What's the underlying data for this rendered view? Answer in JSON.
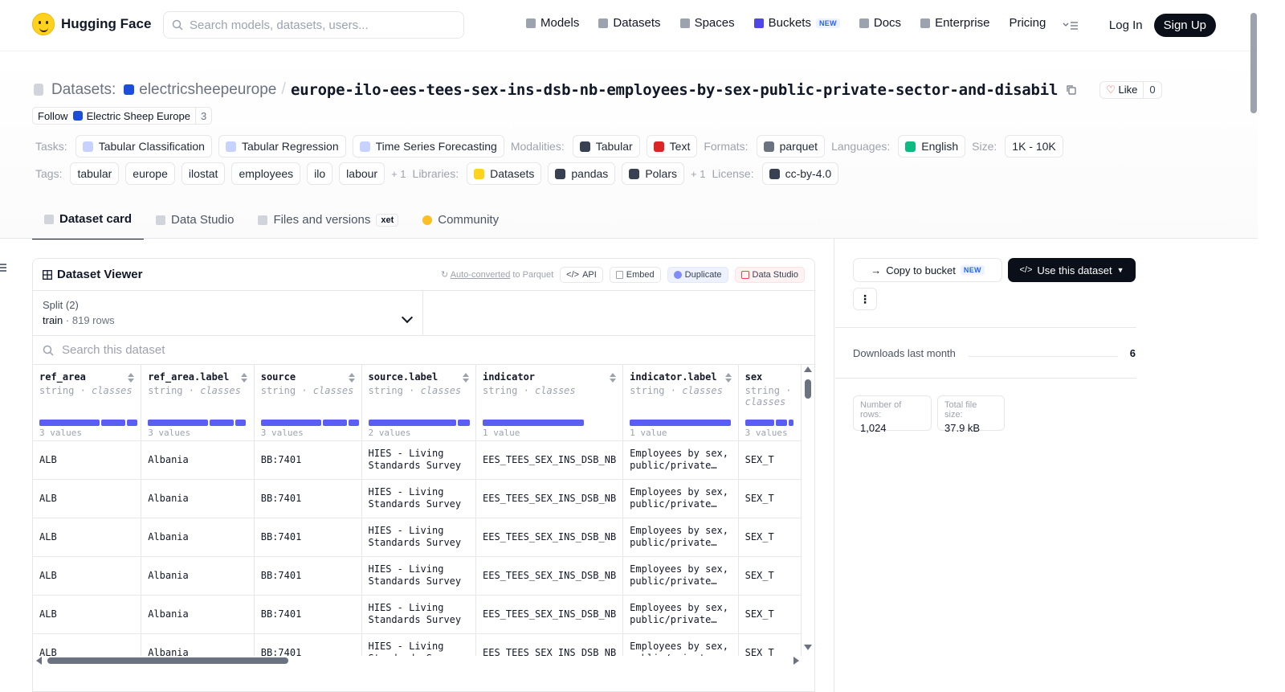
{
  "nav": {
    "brand": "Hugging Face",
    "search_placeholder": "Search models, datasets, users...",
    "items": [
      {
        "label": "Models",
        "icon": "cube-icon",
        "color": "#9ca3af"
      },
      {
        "label": "Datasets",
        "icon": "database-icon",
        "color": "#9ca3af"
      },
      {
        "label": "Spaces",
        "icon": "grid-icon",
        "color": "#9ca3af"
      },
      {
        "label": "Buckets",
        "icon": "bucket-icon",
        "color": "#4f46e5",
        "badge": "NEW"
      },
      {
        "label": "Docs",
        "icon": "book-icon",
        "color": "#9ca3af"
      },
      {
        "label": "Enterprise",
        "icon": "enterprise-icon",
        "color": "#9ca3af"
      },
      {
        "label": "Pricing",
        "icon": "",
        "color": ""
      }
    ],
    "login": "Log In",
    "signup": "Sign Up"
  },
  "header": {
    "prefix": "Datasets:",
    "owner": "electricsheepeurope",
    "name": "europe-ilo-ees-tees-sex-ins-dsb-nb-employees-by-sex-public-private-sector-and-disabil",
    "like_label": "Like",
    "like_count": "0",
    "follow_label": "Follow",
    "follow_org": "Electric Sheep Europe",
    "follow_count": "3"
  },
  "meta": {
    "tasks_label": "Tasks:",
    "tasks": [
      {
        "label": "Tabular Classification",
        "icon": "table-icon"
      },
      {
        "label": "Tabular Regression",
        "icon": "chart-icon"
      },
      {
        "label": "Time Series Forecasting",
        "icon": "timeseries-icon"
      }
    ],
    "modalities_label": "Modalities:",
    "modalities": [
      {
        "label": "Tabular",
        "icon": "tabular-icon",
        "color": "#374151"
      },
      {
        "label": "Text",
        "icon": "text-icon",
        "color": "#dc2626"
      }
    ],
    "formats_label": "Formats:",
    "formats": [
      {
        "label": "parquet",
        "icon": "parquet-icon"
      }
    ],
    "languages_label": "Languages:",
    "languages": [
      {
        "label": "English",
        "icon": "globe-icon",
        "color": "#10b981"
      }
    ],
    "size_label": "Size:",
    "size": "1K - 10K",
    "tags_label": "Tags:",
    "tags": [
      "tabular",
      "europe",
      "ilostat",
      "employees",
      "ilo",
      "labour"
    ],
    "tags_more": "+ 1",
    "libraries_label": "Libraries:",
    "libraries": [
      {
        "label": "Datasets",
        "icon": "hf-icon"
      },
      {
        "label": "pandas",
        "icon": "pandas-icon"
      },
      {
        "label": "Polars",
        "icon": "polars-icon"
      }
    ],
    "libraries_more": "+ 1",
    "license_label": "License:",
    "license": "cc-by-4.0"
  },
  "tabs": [
    {
      "label": "Dataset card",
      "icon": "card-icon",
      "active": true
    },
    {
      "label": "Data Studio",
      "icon": "table-icon",
      "active": false
    },
    {
      "label": "Files and versions",
      "icon": "files-icon",
      "active": false,
      "badge": "xet"
    },
    {
      "label": "Community",
      "icon": "community-icon",
      "active": false
    }
  ],
  "viewer": {
    "title": "Dataset Viewer",
    "auto_link": "Auto-converted",
    "auto_rest": " to Parquet",
    "api": "API",
    "embed": "Embed",
    "duplicate": "Duplicate",
    "studio": "Data Studio",
    "split_label": "Split (2)",
    "split_value": "train",
    "split_rows": "819 rows",
    "search_placeholder": "Search this dataset",
    "columns": [
      {
        "name": "ref_area",
        "type": "string",
        "kind": "classes",
        "stat": "3 values",
        "hist": [
          0.6,
          0.25,
          0.12
        ],
        "width": 144
      },
      {
        "name": "ref_area.label",
        "type": "string",
        "kind": "classes",
        "stat": "3 values",
        "hist": [
          0.6,
          0.25,
          0.12
        ],
        "width": 144
      },
      {
        "name": "source",
        "type": "string",
        "kind": "classes",
        "stat": "3 values",
        "hist": [
          0.6,
          0.25,
          0.12
        ],
        "width": 144
      },
      {
        "name": "source.label",
        "type": "string",
        "kind": "classes",
        "stat": "2 values",
        "hist": [
          0.87,
          0.13
        ],
        "width": 144
      },
      {
        "name": "indicator",
        "type": "string",
        "kind": "classes",
        "stat": "1 value",
        "hist": [
          1.0
        ],
        "width": 178
      },
      {
        "name": "indicator.label",
        "type": "string",
        "kind": "classes",
        "stat": "1 value",
        "hist": [
          1.0
        ],
        "width": 144
      },
      {
        "name": "sex",
        "type": "string",
        "kind": "classes",
        "stat": "3 values",
        "hist": [
          0.6,
          0.25,
          0.12
        ],
        "width": 80
      }
    ],
    "rows": [
      [
        "ALB",
        "Albania",
        "BB:7401",
        "HIES - Living|Standards Survey",
        "EES_TEES_SEX_INS_DSB_NB",
        "Employees by sex,|public/private…",
        "SEX_T"
      ],
      [
        "ALB",
        "Albania",
        "BB:7401",
        "HIES - Living|Standards Survey",
        "EES_TEES_SEX_INS_DSB_NB",
        "Employees by sex,|public/private…",
        "SEX_T"
      ],
      [
        "ALB",
        "Albania",
        "BB:7401",
        "HIES - Living|Standards Survey",
        "EES_TEES_SEX_INS_DSB_NB",
        "Employees by sex,|public/private…",
        "SEX_T"
      ],
      [
        "ALB",
        "Albania",
        "BB:7401",
        "HIES - Living|Standards Survey",
        "EES_TEES_SEX_INS_DSB_NB",
        "Employees by sex,|public/private…",
        "SEX_T"
      ],
      [
        "ALB",
        "Albania",
        "BB:7401",
        "HIES - Living|Standards Survey",
        "EES_TEES_SEX_INS_DSB_NB",
        "Employees by sex,|public/private…",
        "SEX_T"
      ],
      [
        "ALB",
        "Albania",
        "BB:7401",
        "HIES - Living|Standards Survey",
        "EES_TEES_SEX_INS_DSB_NB",
        "Employees by sex,|public/private…",
        "SEX_T"
      ]
    ]
  },
  "right": {
    "copy_bucket": "Copy to bucket",
    "copy_badge": "NEW",
    "use_dataset": "Use this dataset",
    "downloads_label": "Downloads last month",
    "downloads_value": "6",
    "rows_label": "Number of rows:",
    "rows_value": "1,024",
    "size_label": "Total file size:",
    "size_value": "37.9 kB"
  }
}
